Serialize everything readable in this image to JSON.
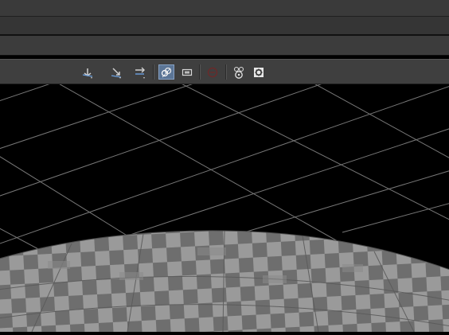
{
  "window": {
    "bands": [
      "title",
      "menu",
      "shelf",
      "toolbar"
    ]
  },
  "toolbar": {
    "tools": [
      {
        "name": "camera-tumble-icon",
        "state": "normal"
      },
      {
        "name": "camera-track-icon",
        "state": "normal"
      },
      {
        "name": "camera-dolly-icon",
        "state": "normal"
      },
      {
        "name": "snapshot-link-icon",
        "state": "active"
      },
      {
        "name": "film-gate-icon",
        "state": "normal"
      },
      {
        "name": "record-disabled-icon",
        "state": "disabled"
      },
      {
        "name": "film-reel-icon",
        "state": "normal"
      },
      {
        "name": "settings-gear-icon",
        "state": "normal"
      }
    ]
  },
  "viewport": {
    "background_color": "#000000",
    "grid_color": "#8c8c8c",
    "object": "checkered-sphere"
  }
}
